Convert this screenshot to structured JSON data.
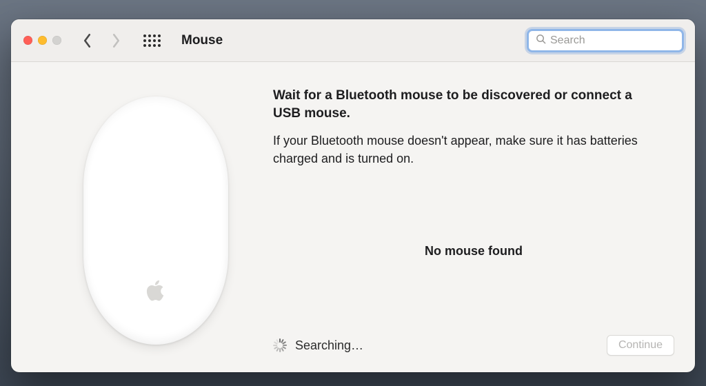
{
  "window": {
    "title": "Mouse"
  },
  "search": {
    "placeholder": "Search",
    "value": ""
  },
  "main": {
    "heading": "Wait for a Bluetooth mouse to be discovered or connect a USB mouse.",
    "subtext": "If your Bluetooth mouse doesn't appear, make sure it has batteries charged and is turned on.",
    "status": "No mouse found",
    "searching_label": "Searching…",
    "continue_label": "Continue"
  }
}
